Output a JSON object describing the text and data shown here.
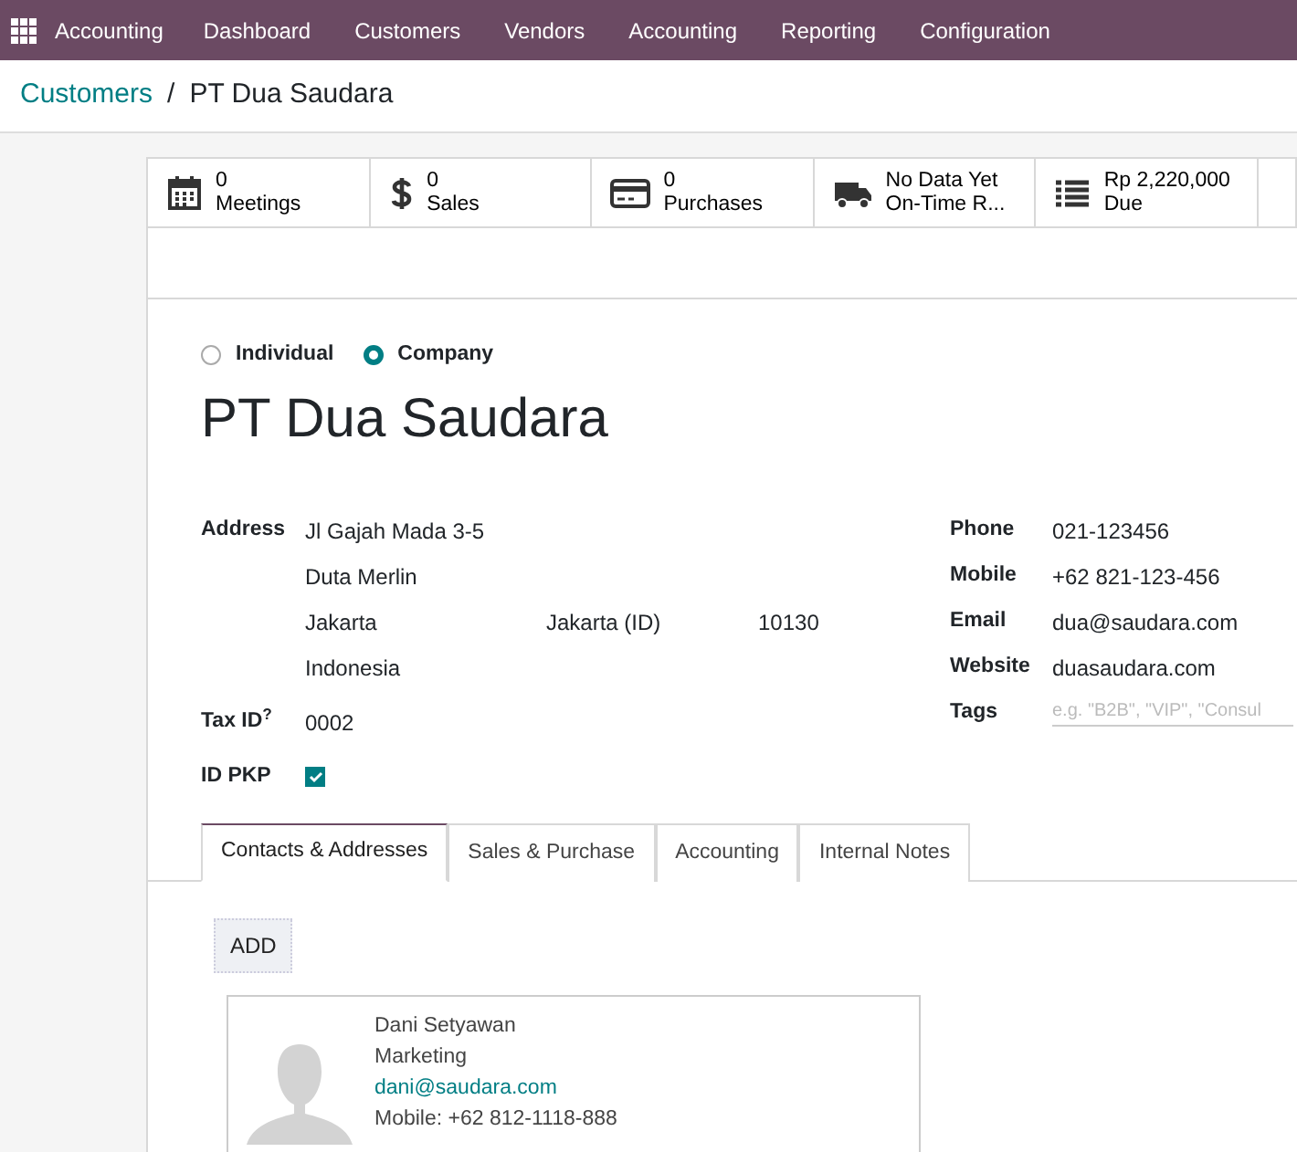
{
  "navbar": {
    "app": "Accounting",
    "menu": [
      "Dashboard",
      "Customers",
      "Vendors",
      "Accounting",
      "Reporting",
      "Configuration"
    ]
  },
  "breadcrumb": {
    "parent": "Customers",
    "separator": "/",
    "current": "PT Dua Saudara"
  },
  "stat_buttons": [
    {
      "value": "0",
      "label": "Meetings"
    },
    {
      "value": "0",
      "label": "Sales"
    },
    {
      "value": "0",
      "label": "Purchases"
    },
    {
      "value": "No Data Yet",
      "label": "On-Time R..."
    },
    {
      "value": "Rp 2,220,000",
      "label": "Due"
    }
  ],
  "company_type": [
    {
      "label": "Individual",
      "selected": false
    },
    {
      "label": "Company",
      "selected": true
    }
  ],
  "name": "PT Dua Saudara",
  "address": {
    "label": "Address",
    "street": "Jl Gajah Mada 3-5",
    "street2": "Duta Merlin",
    "city": "Jakarta",
    "state": "Jakarta (ID)",
    "zip": "10130",
    "country": "Indonesia"
  },
  "left_fields": [
    {
      "kind": "text",
      "label": "Tax ID$^{?}$",
      "value": "0002"
    },
    {
      "kind": "checkbox",
      "label": "ID PKP",
      "checked": true
    }
  ],
  "right_fields": [
    {
      "kind": "text",
      "label": "Phone",
      "value": "021-123456"
    },
    {
      "kind": "text",
      "label": "Mobile",
      "value": "+62 821-123-456"
    },
    {
      "kind": "text",
      "label": "Email",
      "value": "dua@saudara.com"
    },
    {
      "kind": "text",
      "label": "Website",
      "value": "duasaudara.com"
    },
    {
      "kind": "input",
      "label": "Tags",
      "placeholder": "e.g. \"B2B\", \"VIP\", \"Consul"
    }
  ],
  "tabs": [
    {
      "label": "Contacts & Addresses",
      "selected": true
    },
    {
      "label": "Sales & Purchase",
      "selected": false
    },
    {
      "label": "Accounting",
      "selected": false
    },
    {
      "label": "Internal Notes",
      "selected": false
    }
  ],
  "add_button": "ADD",
  "contacts": [
    {
      "name": "Dani Setyawan",
      "function": "Marketing",
      "email": "dani@saudara.com",
      "mobile": "Mobile: +62 812-1118-888"
    }
  ]
}
